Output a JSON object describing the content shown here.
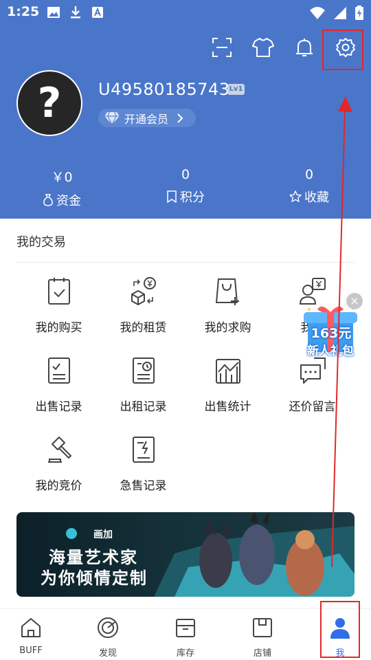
{
  "status": {
    "time": "1:25"
  },
  "profile": {
    "username": "U49580185743",
    "level": "Lv1",
    "vip_label": "开通会员",
    "avatar_glyph": "?"
  },
  "stats": [
    {
      "value": "￥0",
      "label": "资金"
    },
    {
      "value": "0",
      "label": "积分"
    },
    {
      "value": "0",
      "label": "收藏"
    }
  ],
  "trade": {
    "title": "我的交易",
    "items": [
      {
        "label": "我的购买",
        "icon": "clipboard-check-icon"
      },
      {
        "label": "我的租赁",
        "icon": "rent-box-icon"
      },
      {
        "label": "我的求购",
        "icon": "shopping-bag-plus-icon"
      },
      {
        "label": "我的",
        "icon": "user-yen-icon"
      },
      {
        "label": "出售记录",
        "icon": "sale-record-icon"
      },
      {
        "label": "出租记录",
        "icon": "rent-record-icon"
      },
      {
        "label": "出售统计",
        "icon": "chart-icon"
      },
      {
        "label": "还价留言",
        "icon": "chat-icon"
      },
      {
        "label": "我的竞价",
        "icon": "gavel-icon"
      },
      {
        "label": "急售记录",
        "icon": "quick-sale-icon"
      }
    ]
  },
  "promo": {
    "amount": "163元",
    "text": "新人礼包"
  },
  "banner": {
    "brand": "画加",
    "line1": "海量艺术家",
    "line2": "为你倾情定制"
  },
  "tabs": [
    {
      "label": "BUFF",
      "icon": "home-icon"
    },
    {
      "label": "发现",
      "icon": "discover-icon"
    },
    {
      "label": "库存",
      "icon": "inventory-icon"
    },
    {
      "label": "店铺",
      "icon": "store-icon"
    },
    {
      "label": "我",
      "icon": "profile-icon",
      "active": true
    }
  ],
  "colors": {
    "header": "#4a76c9",
    "accent": "#2f6ee8",
    "annotation": "#e02828"
  }
}
